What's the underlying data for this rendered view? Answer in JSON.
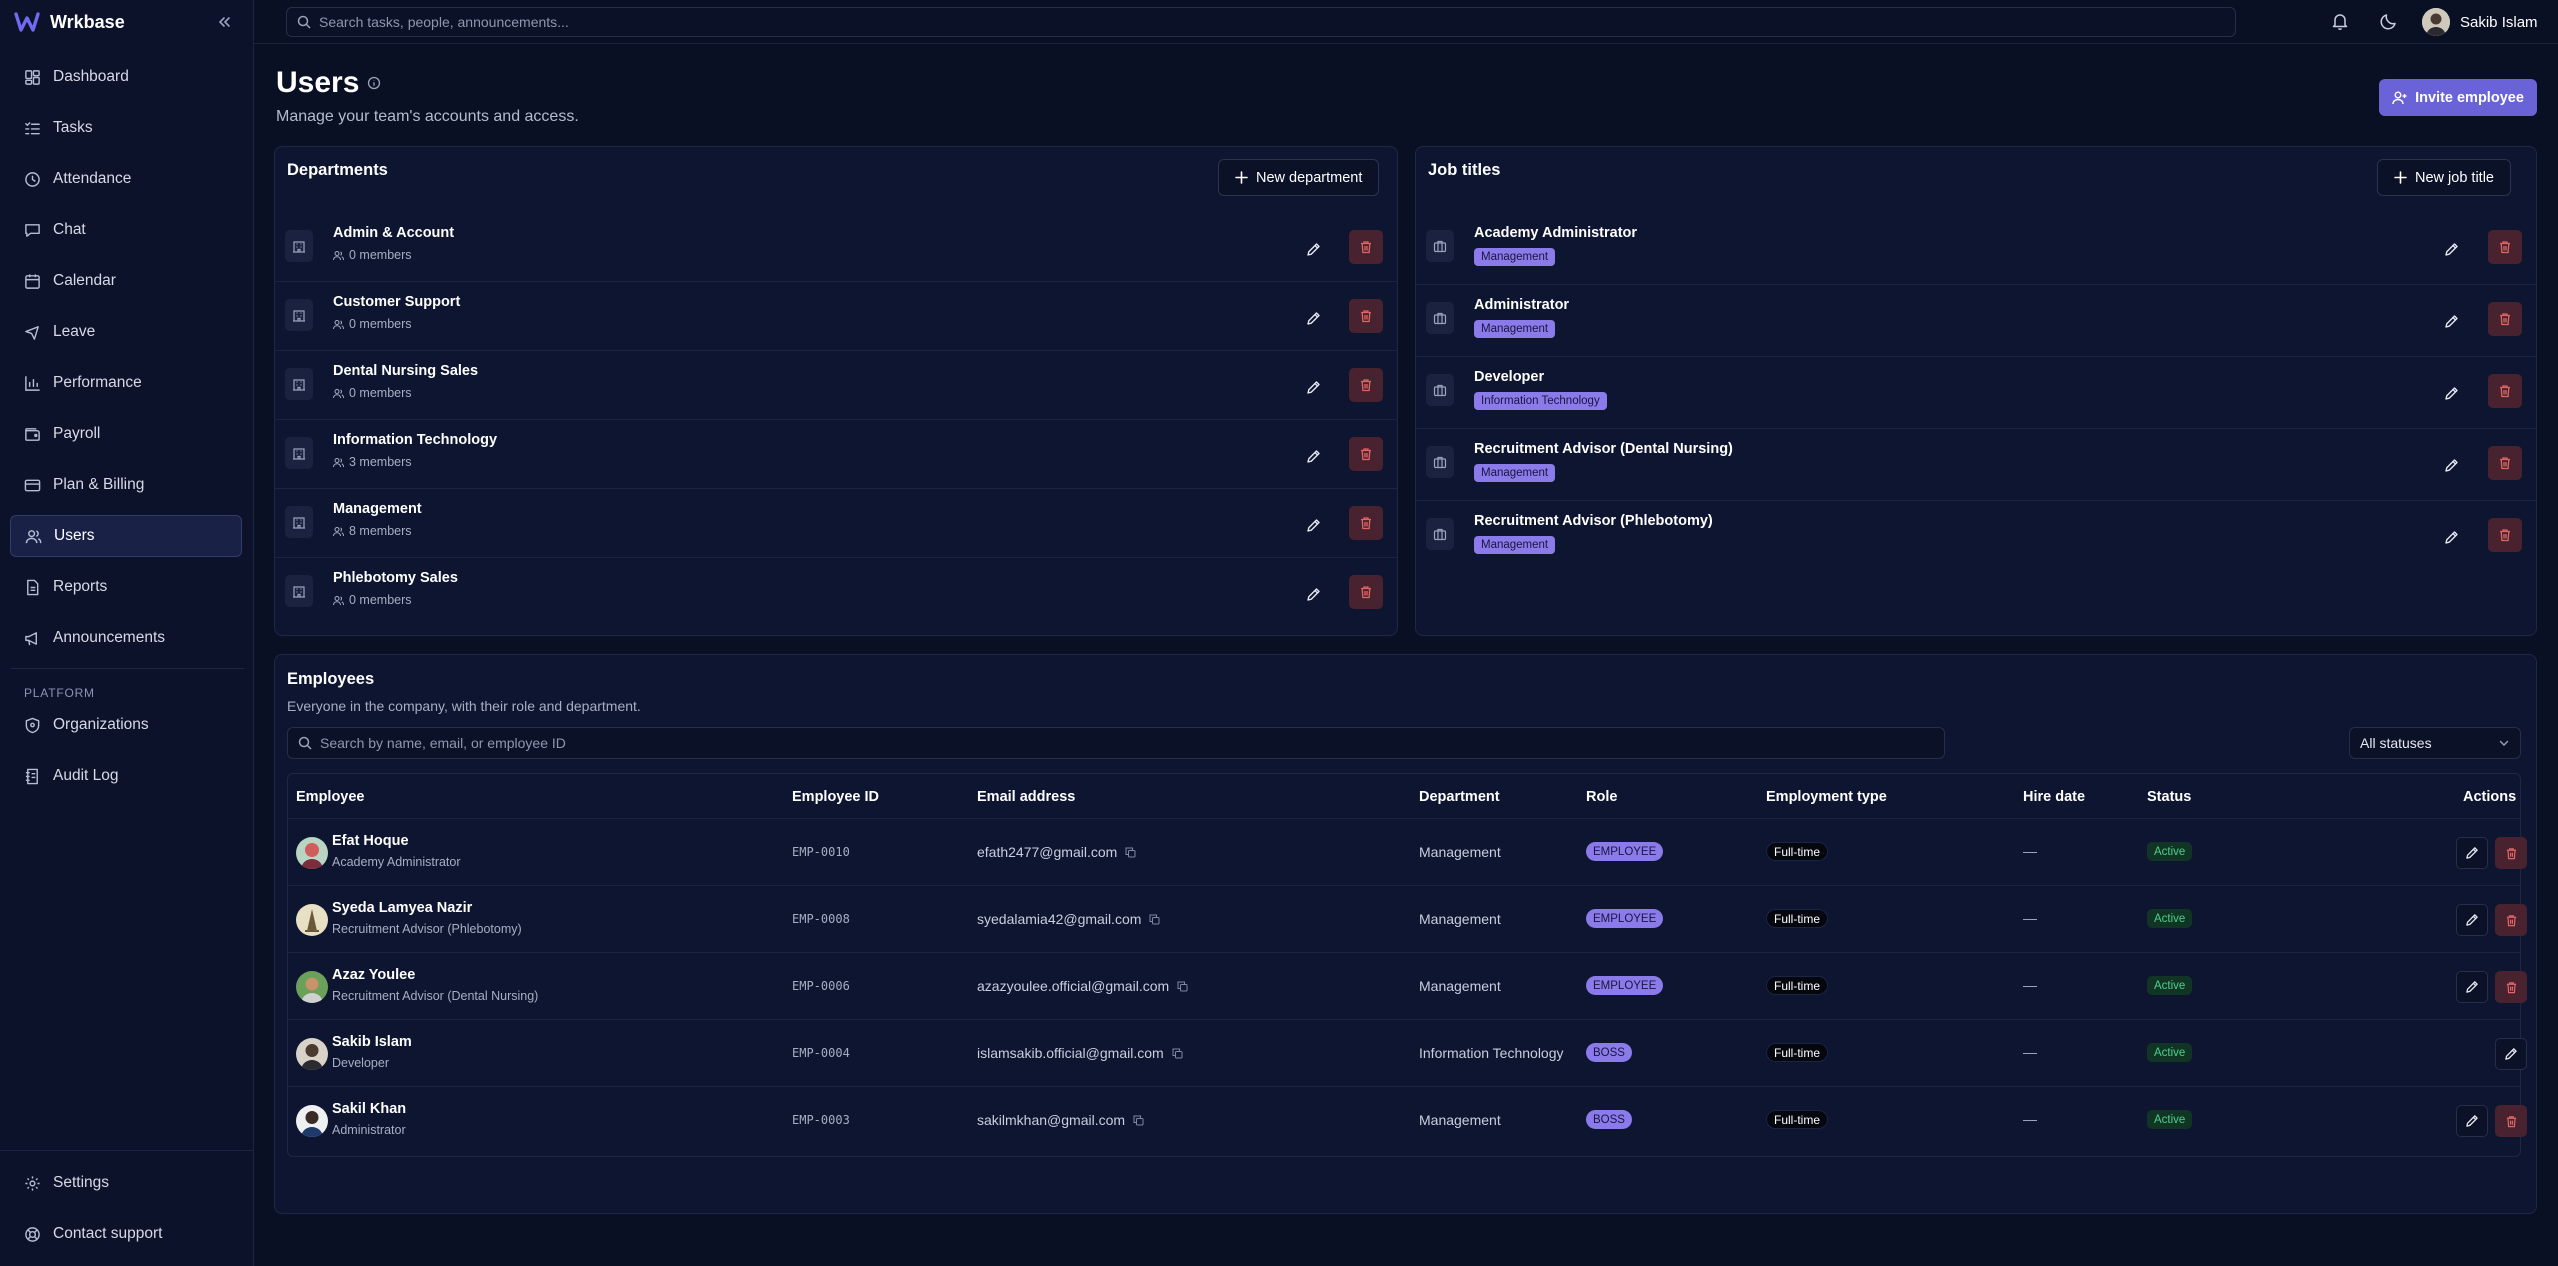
{
  "brand": {
    "name": "Wrkbase"
  },
  "nav": {
    "items": [
      {
        "label": "Dashboard",
        "icon": "dashboard-icon"
      },
      {
        "label": "Tasks",
        "icon": "tasks-icon"
      },
      {
        "label": "Attendance",
        "icon": "clock-icon"
      },
      {
        "label": "Chat",
        "icon": "chat-icon"
      },
      {
        "label": "Calendar",
        "icon": "calendar-icon"
      },
      {
        "label": "Leave",
        "icon": "plane-icon"
      },
      {
        "label": "Performance",
        "icon": "chart-icon"
      },
      {
        "label": "Payroll",
        "icon": "wallet-icon"
      },
      {
        "label": "Plan & Billing",
        "icon": "card-icon"
      },
      {
        "label": "Users",
        "icon": "users-icon",
        "active": true
      },
      {
        "label": "Reports",
        "icon": "file-icon"
      },
      {
        "label": "Announcements",
        "icon": "megaphone-icon"
      }
    ],
    "platform_label": "PLATFORM",
    "platform_items": [
      {
        "label": "Organizations",
        "icon": "shield-icon"
      },
      {
        "label": "Audit Log",
        "icon": "log-icon"
      }
    ],
    "bottom_items": [
      {
        "label": "Settings",
        "icon": "gear-icon"
      },
      {
        "label": "Contact support",
        "icon": "lifebuoy-icon"
      }
    ]
  },
  "topbar": {
    "search_placeholder": "Search tasks, people, announcements...",
    "user_name": "Sakib Islam"
  },
  "page": {
    "title": "Users",
    "subtitle": "Manage your team's accounts and access.",
    "invite_label": "Invite employee"
  },
  "departments": {
    "title": "Departments",
    "new_label": "New department",
    "items": [
      {
        "name": "Admin & Account",
        "members": "0 members"
      },
      {
        "name": "Customer Support",
        "members": "0 members"
      },
      {
        "name": "Dental Nursing Sales",
        "members": "0 members"
      },
      {
        "name": "Information Technology",
        "members": "3 members"
      },
      {
        "name": "Management",
        "members": "8 members"
      },
      {
        "name": "Phlebotomy Sales",
        "members": "0 members"
      }
    ]
  },
  "job_titles": {
    "title": "Job titles",
    "new_label": "New job title",
    "items": [
      {
        "name": "Academy Administrator",
        "dept": "Management"
      },
      {
        "name": "Administrator",
        "dept": "Management"
      },
      {
        "name": "Developer",
        "dept": "Information Technology"
      },
      {
        "name": "Recruitment Advisor (Dental Nursing)",
        "dept": "Management"
      },
      {
        "name": "Recruitment Advisor (Phlebotomy)",
        "dept": "Management"
      }
    ]
  },
  "employees": {
    "title": "Employees",
    "subtitle": "Everyone in the company, with their role and department.",
    "search_placeholder": "Search by name, email, or employee ID",
    "status_filter": "All statuses",
    "columns": [
      "Employee",
      "Employee ID",
      "Email address",
      "Department",
      "Role",
      "Employment type",
      "Hire date",
      "Status",
      "Actions"
    ],
    "rows": [
      {
        "name": "Efat Hoque",
        "job": "Academy Administrator",
        "id": "EMP-0010",
        "email": "efath2477@gmail.com",
        "dept": "Management",
        "role": "EMPLOYEE",
        "type": "Full-time",
        "hire": "—",
        "status": "Active",
        "deletable": true
      },
      {
        "name": "Syeda Lamyea Nazir",
        "job": "Recruitment Advisor (Phlebotomy)",
        "id": "EMP-0008",
        "email": "syedalamia42@gmail.com",
        "dept": "Management",
        "role": "EMPLOYEE",
        "type": "Full-time",
        "hire": "—",
        "status": "Active",
        "deletable": true
      },
      {
        "name": "Azaz Youlee",
        "job": "Recruitment Advisor (Dental Nursing)",
        "id": "EMP-0006",
        "email": "azazyoulee.official@gmail.com",
        "dept": "Management",
        "role": "EMPLOYEE",
        "type": "Full-time",
        "hire": "—",
        "status": "Active",
        "deletable": true
      },
      {
        "name": "Sakib Islam",
        "job": "Developer",
        "id": "EMP-0004",
        "email": "islamsakib.official@gmail.com",
        "dept": "Information Technology",
        "role": "BOSS",
        "type": "Full-time",
        "hire": "—",
        "status": "Active",
        "deletable": false
      },
      {
        "name": "Sakil Khan",
        "job": "Administrator",
        "id": "EMP-0003",
        "email": "sakilmkhan@gmail.com",
        "dept": "Management",
        "role": "BOSS",
        "type": "Full-time",
        "hire": "—",
        "status": "Active",
        "deletable": true
      }
    ]
  },
  "colors": {
    "accent": "#6a63d8",
    "badge": "#8b7bea",
    "danger": "#e26565",
    "success": "#4dd08a",
    "background": "#0a1023"
  }
}
